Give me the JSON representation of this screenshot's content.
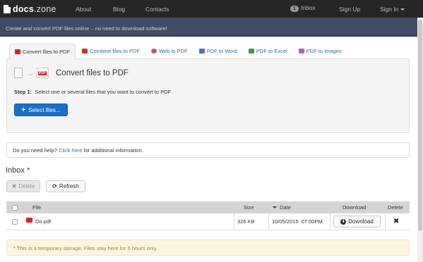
{
  "navbar": {
    "brand_main": "docs",
    "brand_suffix": ".zone",
    "links": [
      "About",
      "Blog",
      "Contacts"
    ],
    "inbox_count": "1",
    "inbox_label": "Inbox",
    "signup": "Sign Up",
    "signin": "Sign In"
  },
  "banner": {
    "text": "Create and convert PDF files online – no need to download software!"
  },
  "tabs": [
    {
      "label": "Convert files to PDF",
      "icon": "pdf-icon"
    },
    {
      "label": "Combine files to PDF",
      "icon": "combine-icon"
    },
    {
      "label": "Web to PDF",
      "icon": "web-icon"
    },
    {
      "label": "PDF to Word",
      "icon": "word-icon"
    },
    {
      "label": "PDF to Excel",
      "icon": "excel-icon"
    },
    {
      "label": "PDF to Images",
      "icon": "images-icon"
    }
  ],
  "panel": {
    "pdf_badge": "PDF",
    "title": "Convert files to PDF",
    "step_label": "Step 1:",
    "step_text": "Select one or several files that you want to convert to PDF",
    "select_button": "Select files..."
  },
  "help": {
    "prefix": "Do you need help?",
    "link": "Click here",
    "suffix": "for additional information."
  },
  "inbox": {
    "title": "Inbox *",
    "delete_button": "Delete",
    "refresh_button": "Refresh"
  },
  "table": {
    "headers": {
      "file": "File",
      "size": "Size",
      "date": "Date",
      "download": "Download",
      "delete": "Delete"
    },
    "rows": [
      {
        "file": "Do.pdf",
        "size": "326 KB",
        "date": "10/05/2015  07:00PM",
        "download": "Download"
      }
    ]
  },
  "notice": {
    "text": "* This is a temporary storage. Files stay here for 6 hours only."
  },
  "colors": {
    "navbar": "#262626",
    "banner": "#3f4c66",
    "primary": "#1a6fc8",
    "link": "#2a6dbf",
    "notice_bg": "#fcf6e1"
  }
}
